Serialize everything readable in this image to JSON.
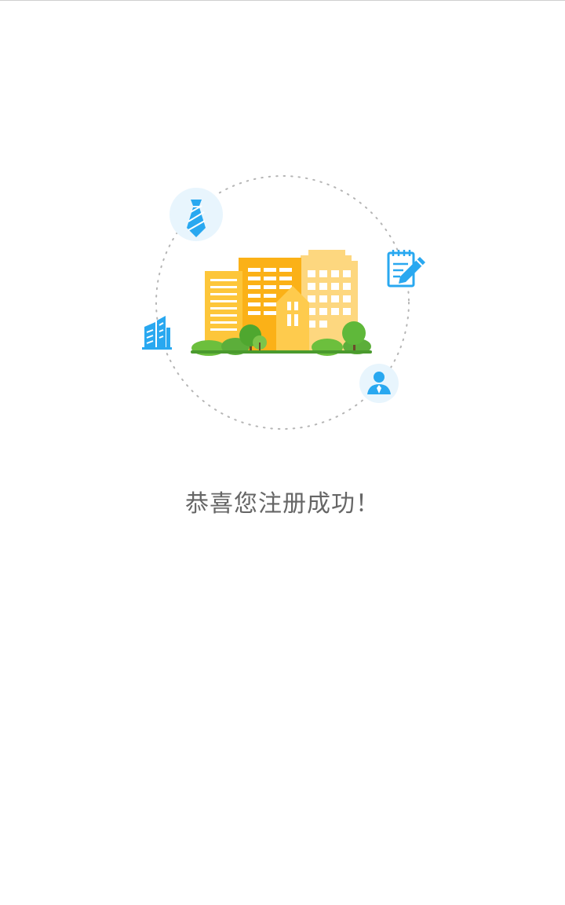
{
  "message": {
    "text": "恭喜您注册成功！"
  },
  "illustration": {
    "orbit_icons": [
      "tie-icon",
      "notepad-pencil-icon",
      "office-building-icon",
      "person-icon"
    ],
    "center_graphic": "city-buildings-icon"
  },
  "colors": {
    "accent_blue": "#29a8f0",
    "icon_bubble": "#e8f5fd",
    "text_gray": "#666666",
    "building_yellow": "#fbc02d",
    "building_orange": "#fbb117",
    "building_light": "#fdd77f",
    "tree_green": "#5cae3a",
    "dotted_ring": "#b5b5b5"
  }
}
